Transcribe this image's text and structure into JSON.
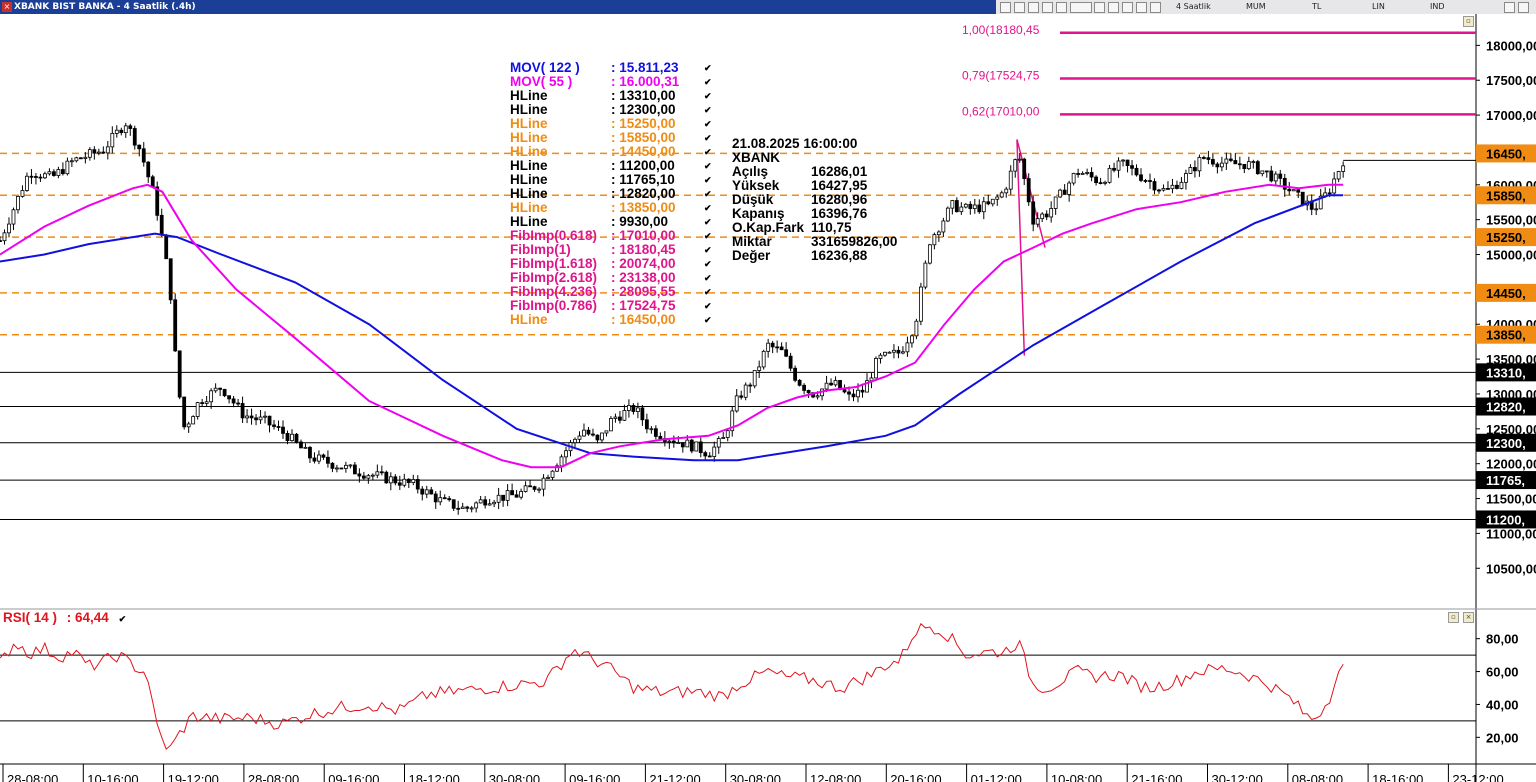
{
  "window": {
    "title": "XBANK BIST BANKA - 4 Saatlik (.4h)",
    "toolbar_labels": [
      "4 Saatlik",
      "MUM",
      "TL",
      "LIN",
      "IND"
    ]
  },
  "legend": [
    {
      "name": "MOV( 122 )",
      "value": ": 15.811,23",
      "color": "#1010e0"
    },
    {
      "name": "MOV( 55 )",
      "value": ": 16.000,31",
      "color": "#f000f0"
    },
    {
      "name": "HLine",
      "value": ": 13310,00",
      "color": "#000000"
    },
    {
      "name": "HLine",
      "value": ": 12300,00",
      "color": "#000000"
    },
    {
      "name": "HLine",
      "value": ": 15250,00",
      "color": "#f08c14"
    },
    {
      "name": "HLine",
      "value": ": 15850,00",
      "color": "#f08c14"
    },
    {
      "name": "HLine",
      "value": ": 14450,00",
      "color": "#f08c14"
    },
    {
      "name": "HLine",
      "value": ": 11200,00",
      "color": "#000000"
    },
    {
      "name": "HLine",
      "value": ": 11765,10",
      "color": "#000000"
    },
    {
      "name": "HLine",
      "value": ": 12820,00",
      "color": "#000000"
    },
    {
      "name": "HLine",
      "value": ": 13850,00",
      "color": "#f08c14"
    },
    {
      "name": "HLine",
      "value": ": 9930,00",
      "color": "#000000"
    },
    {
      "name": "FibImp(0.618)",
      "value": ": 17010,00",
      "color": "#e0148c"
    },
    {
      "name": "FibImp(1)",
      "value": ": 18180,45",
      "color": "#e0148c"
    },
    {
      "name": "FibImp(1.618)",
      "value": ": 20074,00",
      "color": "#e0148c"
    },
    {
      "name": "FibImp(2.618)",
      "value": ": 23138,00",
      "color": "#e0148c"
    },
    {
      "name": "FibImp(4.236)",
      "value": ": 28095,55",
      "color": "#e0148c"
    },
    {
      "name": "FibImp(0.786)",
      "value": ": 17524,75",
      "color": "#e0148c"
    },
    {
      "name": "HLine",
      "value": ": 16450,00",
      "color": "#f08c14"
    }
  ],
  "info": {
    "datetime": "21.08.2025  16:00:00",
    "symbol": "XBANK",
    "rows": [
      {
        "label": "Açılış",
        "value": "16286,01"
      },
      {
        "label": "Yüksek",
        "value": "16427,95"
      },
      {
        "label": "Düşük",
        "value": "16280,96"
      },
      {
        "label": "Kapanış",
        "value": "16396,76"
      },
      {
        "label": "O.Kap.Fark",
        "value": "110,75"
      },
      {
        "label": "Miktar",
        "value": "331659826,00"
      },
      {
        "label": "Değer",
        "value": "16236,88"
      }
    ]
  },
  "rsi": {
    "label": "RSI( 14 )",
    "value": ": 64,44"
  },
  "colors": {
    "orange": "#f08c14",
    "fib": "#e0148c",
    "mov122": "#1010e0",
    "mov55": "#f000f0",
    "rsi": "#e0141d"
  },
  "chart_data": {
    "type": "candlestick",
    "price_axis": {
      "ylim": [
        9930,
        18450
      ],
      "ticks": [
        10500,
        11000,
        11500,
        12000,
        12500,
        13000,
        13500,
        14000,
        14500,
        15000,
        15500,
        16000,
        16500,
        17000,
        17500,
        18000
      ],
      "tick_labels": [
        "10500,00",
        "11000,00",
        "11500,00",
        "12000,00",
        "12500,00",
        "13000,00",
        "13500,00",
        "14000,00",
        "14500,00",
        "15000,00",
        "15500,00",
        "16000,00",
        "16500,00",
        "17000,00",
        "17500,00",
        "18000,00"
      ]
    },
    "x_ticks": [
      "28-08:00",
      "10-16:00",
      "19-12:00",
      "28-08:00",
      "09-16:00",
      "18-12:00",
      "30-08:00",
      "09-16:00",
      "21-12:00",
      "30-08:00",
      "12-08:00",
      "20-16:00",
      "01-12:00",
      "10-08:00",
      "21-16:00",
      "30-12:00",
      "08-08:00",
      "18-16:00",
      "23-12:00"
    ],
    "hlines": [
      {
        "value": 16450,
        "label": "16450,",
        "style": "dashed",
        "color": "#f08c14"
      },
      {
        "value": 15850,
        "label": "15850,",
        "style": "dashed",
        "color": "#f08c14"
      },
      {
        "value": 15250,
        "label": "15250,",
        "style": "dashed",
        "color": "#f08c14"
      },
      {
        "value": 14450,
        "label": "14450,",
        "style": "dashed",
        "color": "#f08c14"
      },
      {
        "value": 13850,
        "label": "13850,",
        "style": "dashed",
        "color": "#f08c14"
      },
      {
        "value": 13310,
        "label": "13310,",
        "style": "solid",
        "color": "#000000"
      },
      {
        "value": 12820,
        "label": "12820,",
        "style": "solid",
        "color": "#000000"
      },
      {
        "value": 12300,
        "label": "12300,",
        "style": "solid",
        "color": "#000000"
      },
      {
        "value": 11765,
        "label": "11765,",
        "style": "solid",
        "color": "#000000"
      },
      {
        "value": 11200,
        "label": "11200,",
        "style": "solid",
        "color": "#000000"
      }
    ],
    "fib_levels": [
      {
        "value": 18180.45,
        "label": "1,00(18180,45"
      },
      {
        "value": 17524.75,
        "label": "0,79(17524,75"
      },
      {
        "value": 17010.0,
        "label": "0,62(17010,00"
      }
    ],
    "fib_swing": [
      [
        0.694,
        13550
      ],
      [
        0.689,
        16650
      ],
      [
        0.708,
        15100
      ]
    ],
    "price_path": [
      [
        0.0,
        15200
      ],
      [
        0.01,
        15700
      ],
      [
        0.02,
        16200
      ],
      [
        0.035,
        16100
      ],
      [
        0.05,
        16350
      ],
      [
        0.07,
        16500
      ],
      [
        0.085,
        16900
      ],
      [
        0.095,
        16500
      ],
      [
        0.105,
        15800
      ],
      [
        0.115,
        14600
      ],
      [
        0.12,
        13200
      ],
      [
        0.125,
        12500
      ],
      [
        0.135,
        12900
      ],
      [
        0.15,
        13100
      ],
      [
        0.165,
        12700
      ],
      [
        0.18,
        12600
      ],
      [
        0.195,
        12400
      ],
      [
        0.21,
        12100
      ],
      [
        0.225,
        12000
      ],
      [
        0.24,
        11900
      ],
      [
        0.26,
        11800
      ],
      [
        0.28,
        11700
      ],
      [
        0.3,
        11450
      ],
      [
        0.315,
        11350
      ],
      [
        0.33,
        11500
      ],
      [
        0.35,
        11550
      ],
      [
        0.365,
        11700
      ],
      [
        0.38,
        12100
      ],
      [
        0.395,
        12500
      ],
      [
        0.405,
        12300
      ],
      [
        0.415,
        12650
      ],
      [
        0.43,
        12800
      ],
      [
        0.44,
        12500
      ],
      [
        0.455,
        12350
      ],
      [
        0.47,
        12250
      ],
      [
        0.48,
        12150
      ],
      [
        0.49,
        12350
      ],
      [
        0.5,
        12950
      ],
      [
        0.51,
        13200
      ],
      [
        0.52,
        13700
      ],
      [
        0.53,
        13600
      ],
      [
        0.54,
        13200
      ],
      [
        0.55,
        13000
      ],
      [
        0.565,
        13150
      ],
      [
        0.575,
        12950
      ],
      [
        0.585,
        13050
      ],
      [
        0.595,
        13500
      ],
      [
        0.61,
        13600
      ],
      [
        0.62,
        14000
      ],
      [
        0.63,
        15200
      ],
      [
        0.645,
        15700
      ],
      [
        0.655,
        15650
      ],
      [
        0.67,
        15700
      ],
      [
        0.68,
        15900
      ],
      [
        0.69,
        16450
      ],
      [
        0.7,
        15500
      ],
      [
        0.71,
        15600
      ],
      [
        0.72,
        15900
      ],
      [
        0.73,
        16200
      ],
      [
        0.745,
        16050
      ],
      [
        0.76,
        16300
      ],
      [
        0.775,
        16100
      ],
      [
        0.79,
        15900
      ],
      [
        0.805,
        16150
      ],
      [
        0.815,
        16400
      ],
      [
        0.83,
        16300
      ],
      [
        0.845,
        16300
      ],
      [
        0.86,
        16150
      ],
      [
        0.875,
        15900
      ],
      [
        0.89,
        15650
      ],
      [
        0.9,
        15900
      ],
      [
        0.91,
        16350
      ]
    ],
    "mov122_path": [
      [
        0.0,
        14900
      ],
      [
        0.03,
        15000
      ],
      [
        0.06,
        15150
      ],
      [
        0.09,
        15250
      ],
      [
        0.105,
        15300
      ],
      [
        0.12,
        15250
      ],
      [
        0.15,
        15000
      ],
      [
        0.2,
        14600
      ],
      [
        0.25,
        14000
      ],
      [
        0.3,
        13200
      ],
      [
        0.35,
        12500
      ],
      [
        0.4,
        12150
      ],
      [
        0.43,
        12100
      ],
      [
        0.47,
        12050
      ],
      [
        0.5,
        12050
      ],
      [
        0.53,
        12150
      ],
      [
        0.56,
        12250
      ],
      [
        0.6,
        12400
      ],
      [
        0.62,
        12550
      ],
      [
        0.65,
        13000
      ],
      [
        0.7,
        13700
      ],
      [
        0.75,
        14300
      ],
      [
        0.8,
        14900
      ],
      [
        0.85,
        15450
      ],
      [
        0.9,
        15850
      ],
      [
        0.91,
        15850
      ]
    ],
    "mov55_path": [
      [
        0.0,
        15000
      ],
      [
        0.03,
        15400
      ],
      [
        0.06,
        15700
      ],
      [
        0.09,
        15950
      ],
      [
        0.1,
        16000
      ],
      [
        0.11,
        15900
      ],
      [
        0.13,
        15200
      ],
      [
        0.16,
        14500
      ],
      [
        0.2,
        13800
      ],
      [
        0.25,
        12900
      ],
      [
        0.3,
        12400
      ],
      [
        0.34,
        12050
      ],
      [
        0.36,
        11950
      ],
      [
        0.38,
        11950
      ],
      [
        0.4,
        12150
      ],
      [
        0.42,
        12250
      ],
      [
        0.45,
        12350
      ],
      [
        0.48,
        12400
      ],
      [
        0.5,
        12550
      ],
      [
        0.52,
        12800
      ],
      [
        0.54,
        12950
      ],
      [
        0.56,
        13050
      ],
      [
        0.58,
        13100
      ],
      [
        0.6,
        13250
      ],
      [
        0.62,
        13450
      ],
      [
        0.64,
        14000
      ],
      [
        0.66,
        14500
      ],
      [
        0.68,
        14900
      ],
      [
        0.7,
        15100
      ],
      [
        0.72,
        15300
      ],
      [
        0.74,
        15450
      ],
      [
        0.77,
        15650
      ],
      [
        0.8,
        15750
      ],
      [
        0.83,
        15900
      ],
      [
        0.86,
        16000
      ],
      [
        0.88,
        15950
      ],
      [
        0.9,
        16000
      ],
      [
        0.91,
        16000
      ]
    ],
    "rsi_axis": {
      "ylim": [
        5,
        95
      ],
      "ticks": [
        20,
        40,
        60,
        80
      ],
      "tick_labels": [
        "20,00",
        "40,00",
        "60,00",
        "80,00"
      ],
      "levels": [
        30,
        70
      ]
    },
    "rsi_path": [
      [
        0.0,
        65
      ],
      [
        0.01,
        78
      ],
      [
        0.02,
        71
      ],
      [
        0.03,
        74
      ],
      [
        0.04,
        69
      ],
      [
        0.05,
        72
      ],
      [
        0.06,
        63
      ],
      [
        0.07,
        66
      ],
      [
        0.08,
        70
      ],
      [
        0.09,
        64
      ],
      [
        0.1,
        58
      ],
      [
        0.105,
        30
      ],
      [
        0.11,
        18
      ],
      [
        0.115,
        12
      ],
      [
        0.12,
        20
      ],
      [
        0.13,
        33
      ],
      [
        0.15,
        31
      ],
      [
        0.17,
        32
      ],
      [
        0.19,
        28
      ],
      [
        0.21,
        34
      ],
      [
        0.23,
        38
      ],
      [
        0.25,
        40
      ],
      [
        0.27,
        36
      ],
      [
        0.29,
        46
      ],
      [
        0.31,
        48
      ],
      [
        0.33,
        50
      ],
      [
        0.35,
        52
      ],
      [
        0.37,
        54
      ],
      [
        0.385,
        70
      ],
      [
        0.39,
        73
      ],
      [
        0.4,
        68
      ],
      [
        0.41,
        64
      ],
      [
        0.43,
        50
      ],
      [
        0.45,
        47
      ],
      [
        0.47,
        48
      ],
      [
        0.49,
        45
      ],
      [
        0.5,
        52
      ],
      [
        0.52,
        60
      ],
      [
        0.53,
        57
      ],
      [
        0.55,
        55
      ],
      [
        0.57,
        50
      ],
      [
        0.59,
        58
      ],
      [
        0.6,
        64
      ],
      [
        0.61,
        67
      ],
      [
        0.62,
        85
      ],
      [
        0.63,
        88
      ],
      [
        0.64,
        84
      ],
      [
        0.655,
        70
      ],
      [
        0.67,
        72
      ],
      [
        0.68,
        72
      ],
      [
        0.69,
        78
      ],
      [
        0.7,
        52
      ],
      [
        0.71,
        50
      ],
      [
        0.72,
        55
      ],
      [
        0.73,
        60
      ],
      [
        0.74,
        57
      ],
      [
        0.76,
        58
      ],
      [
        0.77,
        52
      ],
      [
        0.78,
        50
      ],
      [
        0.8,
        55
      ],
      [
        0.81,
        60
      ],
      [
        0.83,
        62
      ],
      [
        0.845,
        58
      ],
      [
        0.86,
        52
      ],
      [
        0.875,
        43
      ],
      [
        0.885,
        33
      ],
      [
        0.89,
        31
      ],
      [
        0.9,
        42
      ],
      [
        0.905,
        58
      ],
      [
        0.91,
        64.44
      ]
    ]
  }
}
